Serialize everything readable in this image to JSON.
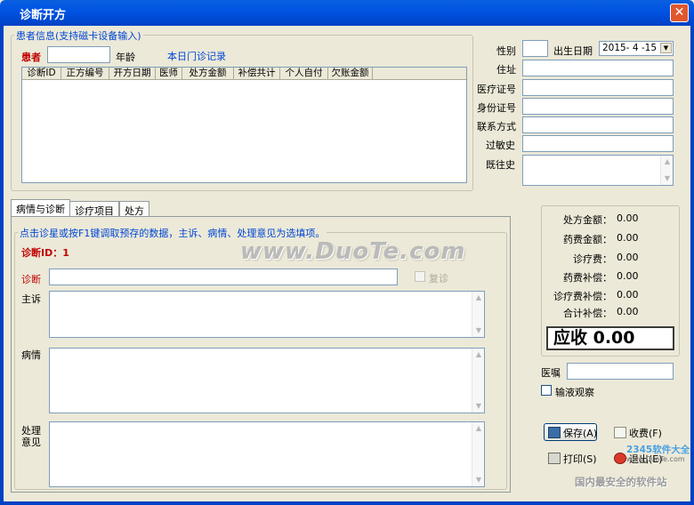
{
  "window": {
    "title": "诊断开方",
    "close_glyph": "✕"
  },
  "patient_group": {
    "legend": "患者信息(支持磁卡设备输入)",
    "patient_label": "患者",
    "patient_value": "",
    "age_label": "年龄",
    "visit_link": "本日门诊记录",
    "grid_columns": [
      "诊断ID",
      "正方编号",
      "开方日期",
      "医师",
      "处方金额",
      "补偿共计",
      "个人自付",
      "欠账金额"
    ]
  },
  "right_fields": {
    "gender_label": "性别",
    "gender_value": "",
    "dob_label": "出生日期",
    "dob_value": "2015- 4 -15",
    "address_label": "住址",
    "medical_id_label": "医疗证号",
    "id_card_label": "身份证号",
    "contact_label": "联系方式",
    "allergy_label": "过敏史",
    "history_label": "既往史"
  },
  "tabs": [
    "病情与诊断",
    "诊疗项目",
    "处方"
  ],
  "diagnosis_panel": {
    "legend": "点击诊星或按F1键调取预存的数据，主诉、病情、处理意见为选填项。",
    "diagnosis_id_label": "诊断ID：1",
    "diagnosis_label": "诊断",
    "revisit_label": "复诊",
    "complaint_label": "主诉",
    "condition_label": "病情",
    "treatment_label_line1": "处理",
    "treatment_label_line2": "意见"
  },
  "summary": {
    "rows": [
      {
        "label": "处方金额：",
        "value": "0.00"
      },
      {
        "label": "药费金额：",
        "value": "0.00"
      },
      {
        "label": "诊疗费：",
        "value": "0.00"
      },
      {
        "label": "药费补偿：",
        "value": "0.00"
      },
      {
        "label": "诊疗费补偿：",
        "value": "0.00"
      },
      {
        "label": "合计补偿：",
        "value": "0.00"
      }
    ],
    "due_text": "应收 0.00"
  },
  "advice": {
    "label": "医嘱",
    "infusion_label": "输液观察"
  },
  "buttons": {
    "save": "保存(A)",
    "charge": "收费(F)",
    "print": "打印(S)",
    "exit": "退出(E)"
  },
  "watermarks": {
    "main": "www.DuoTe.com",
    "corner_brand": "2345软件大全",
    "corner_url": "www.DuoTe.com",
    "corner_tagline": "国内最安全的软件站"
  },
  "colors": {
    "titlebar": "#0054e3",
    "accent_blue": "#0046d5",
    "accent_red": "#c00000"
  }
}
